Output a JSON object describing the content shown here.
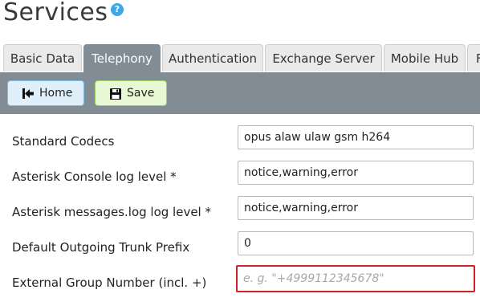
{
  "page": {
    "title": "Services",
    "help_icon": "question-mark-icon",
    "help_glyph": "?"
  },
  "tabs": [
    {
      "label": "Basic Data",
      "active": false
    },
    {
      "label": "Telephony",
      "active": true
    },
    {
      "label": "Authentication",
      "active": false
    },
    {
      "label": "Exchange Server",
      "active": false
    },
    {
      "label": "Mobile Hub",
      "active": false
    },
    {
      "label": "F",
      "active": false
    }
  ],
  "toolbar": {
    "home_label": "Home",
    "home_icon": "go-first-icon",
    "save_label": "Save",
    "save_icon": "floppy-disk-icon"
  },
  "form": {
    "fields": [
      {
        "label": "Standard Codecs",
        "value": "opus alaw ulaw gsm h264",
        "placeholder": ""
      },
      {
        "label": "Asterisk Console log level *",
        "value": "notice,warning,error",
        "placeholder": ""
      },
      {
        "label": "Asterisk messages.log log level *",
        "value": "notice,warning,error",
        "placeholder": ""
      },
      {
        "label": "Default Outgoing Trunk Prefix",
        "value": "0",
        "placeholder": ""
      },
      {
        "label": "External Group Number (incl. +)",
        "value": "",
        "placeholder": "e. g. \"+4999112345678\"",
        "error": true
      }
    ]
  },
  "colors": {
    "active_tab": "#828c95",
    "toolbar_bg": "#828c95",
    "home_btn_bg": "#dff0fb",
    "save_btn_bg": "#e9f8d4",
    "error_border": "#d11f2a",
    "help_icon": "#3da8e8"
  }
}
